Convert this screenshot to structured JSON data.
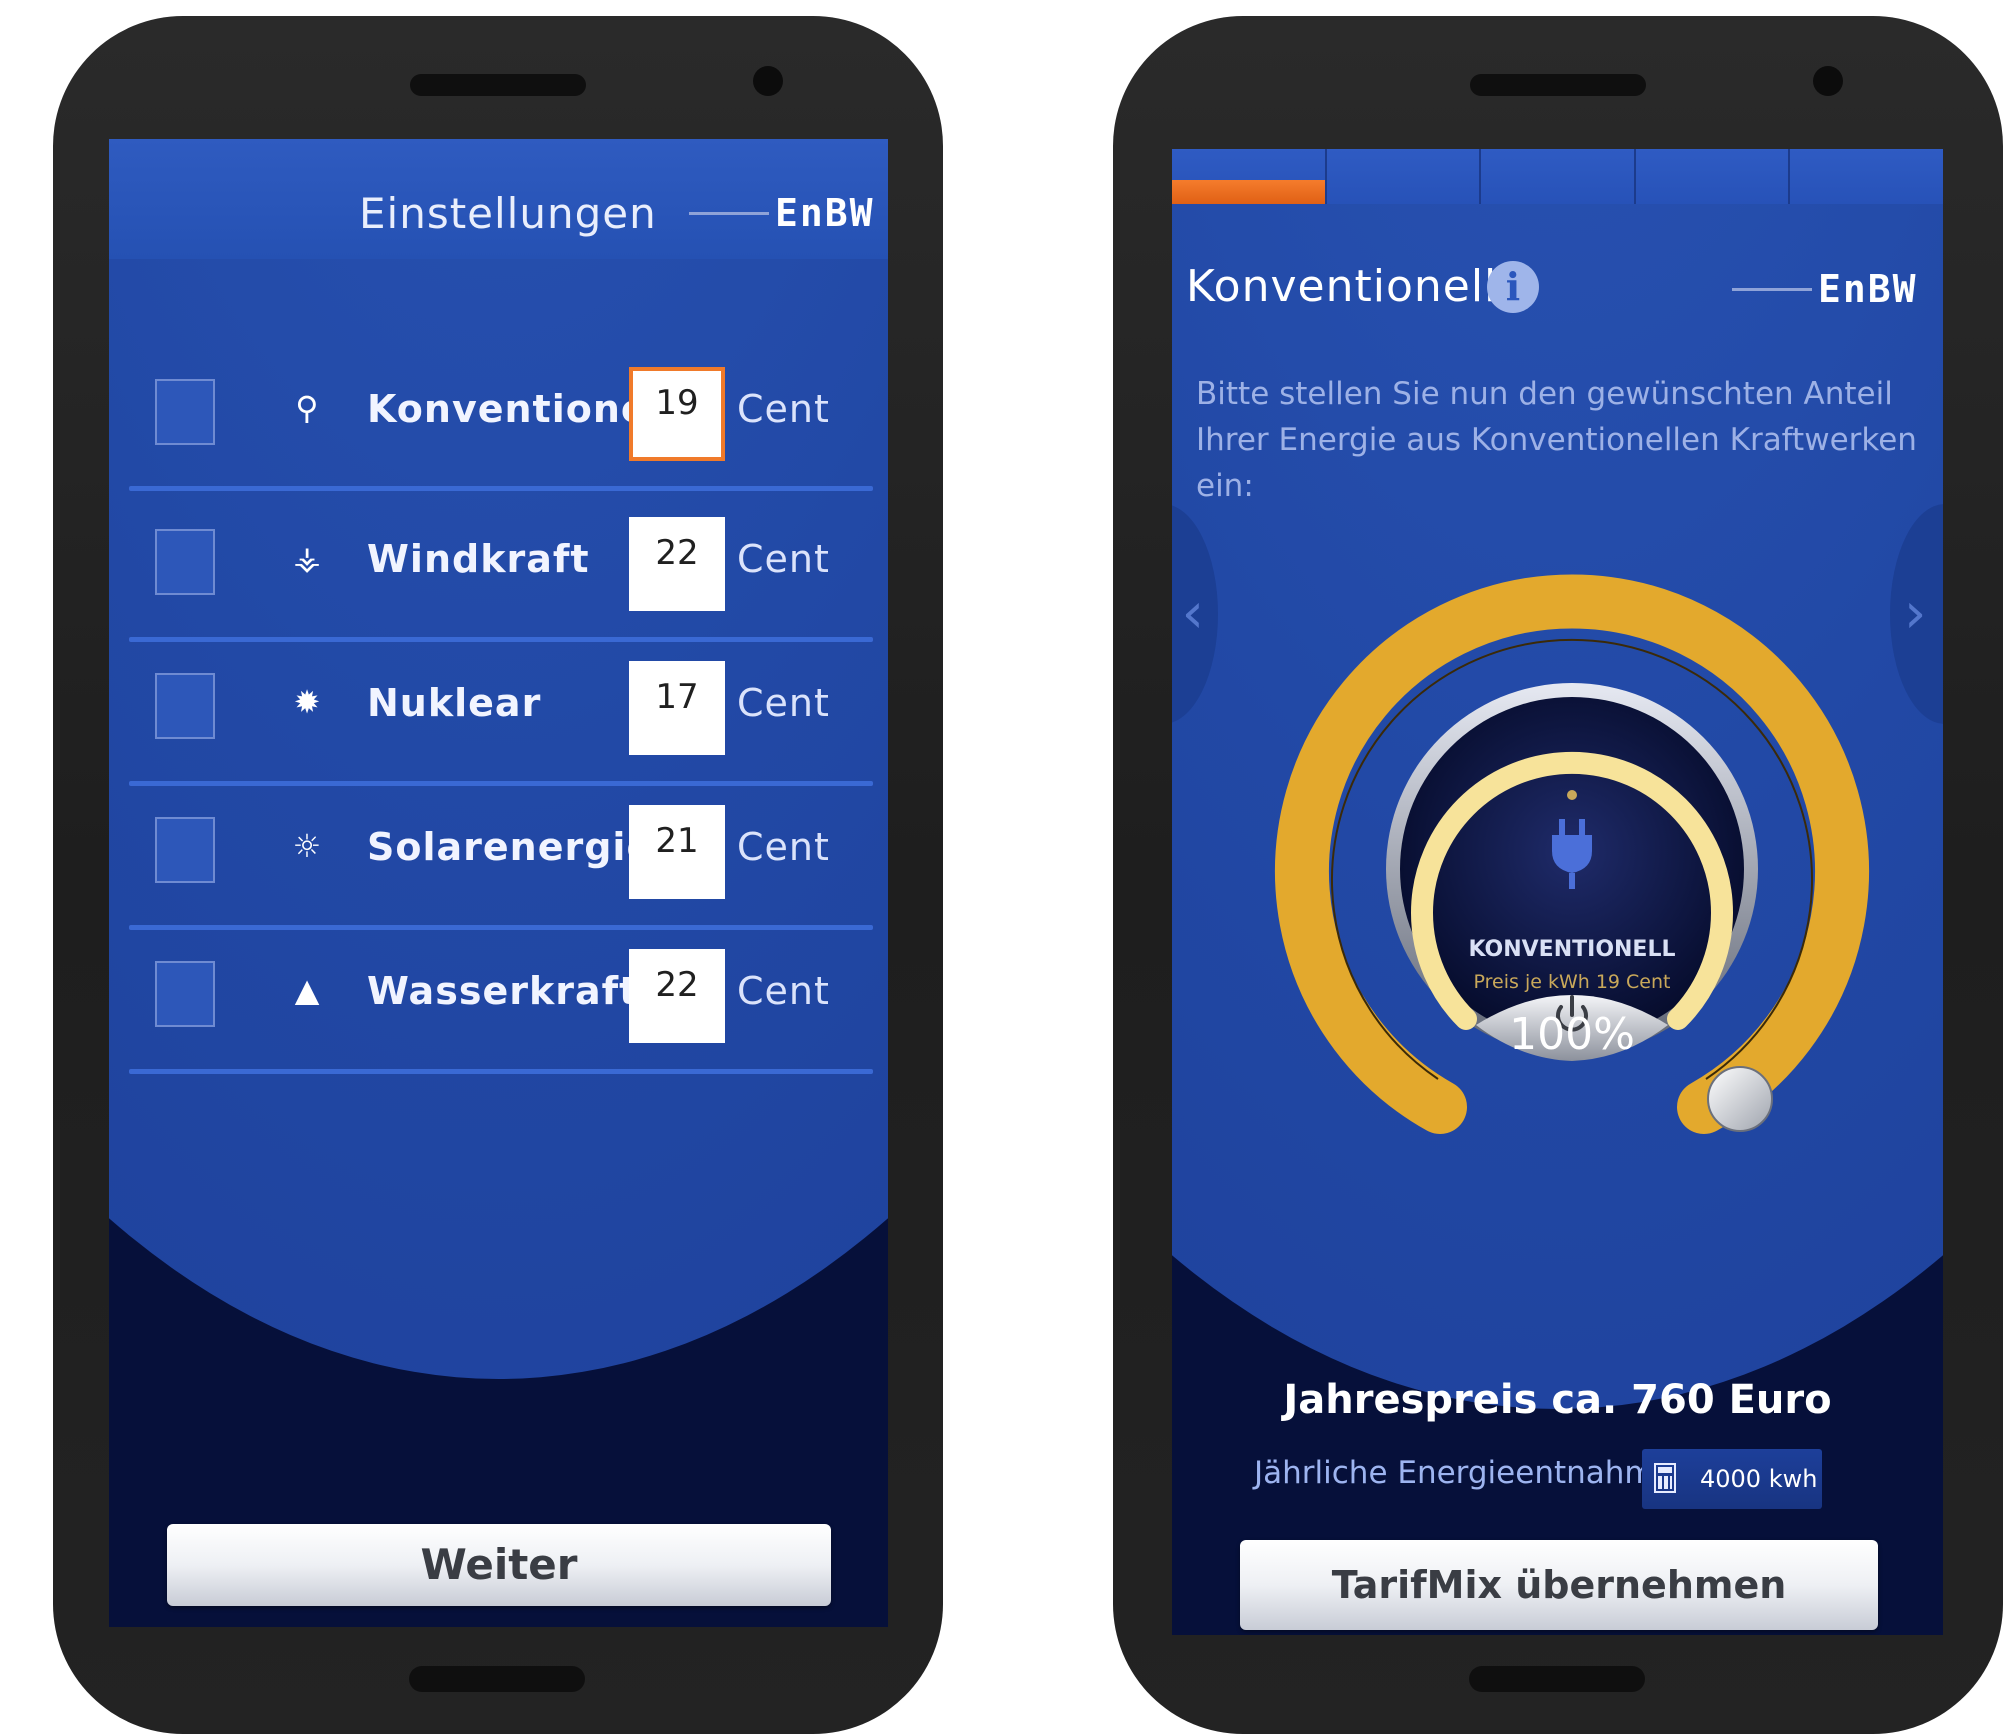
{
  "left_screen": {
    "title": "Einstellungen",
    "logo": "EnBW",
    "rows": [
      {
        "icon": "plug-icon",
        "icon_glyph": "⚲",
        "label": "Konventionell",
        "price": "19",
        "unit": "Cent",
        "active": true
      },
      {
        "icon": "wind-turbine-icon",
        "icon_glyph": "⚶",
        "label": "Windkraft",
        "price": "22",
        "unit": "Cent"
      },
      {
        "icon": "nuclear-icon",
        "icon_glyph": "✹",
        "label": "Nuklear",
        "price": "17",
        "unit": "Cent"
      },
      {
        "icon": "solar-panel-icon",
        "icon_glyph": "☼",
        "label": "Solarenergie",
        "price": "21",
        "unit": "Cent"
      },
      {
        "icon": "water-drop-icon",
        "icon_glyph": "▲",
        "label": "Wasserkraft",
        "price": "22",
        "unit": "Cent"
      }
    ],
    "button": "Weiter"
  },
  "right_screen": {
    "title": "Konventionell",
    "info_glyph": "i",
    "logo": "EnBW",
    "description": "Bitte stellen Sie nun den gewünschten Anteil Ihrer Energie aus Konventionellen Kraftwerken ein:",
    "dial": {
      "name": "KONVENTIONELL",
      "price_text": "Preis je kWh 19 Cent",
      "percent_text": "100%",
      "percent": 100
    },
    "annual_price": "Jahrespreis ca. 760 Euro",
    "consumption_label": "Jährliche Energieentnahme",
    "consumption_value": "4000 kwh",
    "button": "TarifMix übernehmen"
  },
  "colors": {
    "screen_blue": "#2249a6",
    "dark_navy": "#06103a",
    "accent_orange": "#f07a2a",
    "dial_gold": "#e3a92d"
  }
}
